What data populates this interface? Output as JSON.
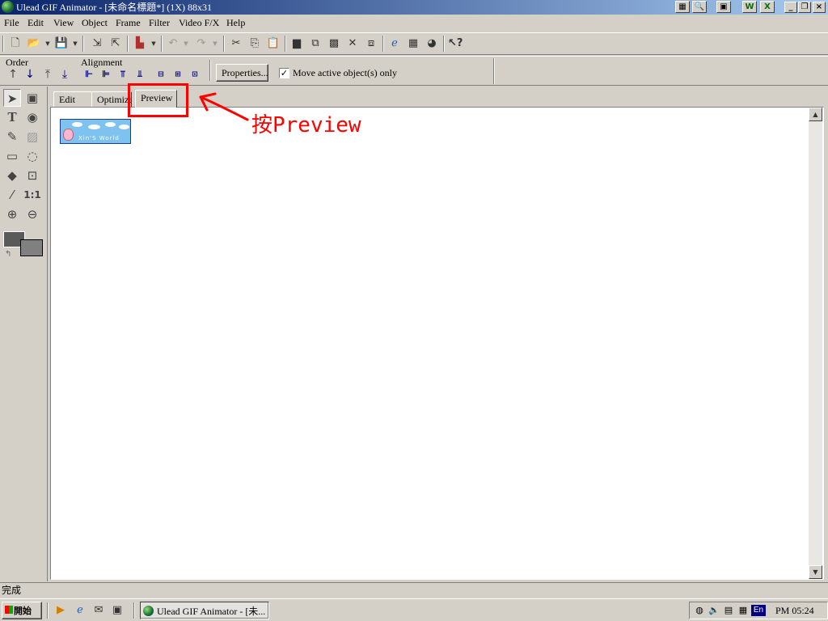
{
  "window": {
    "title": "Ulead GIF Animator - [未命名標題*] (1X) 88x31"
  },
  "menu": [
    "File",
    "Edit",
    "View",
    "Object",
    "Frame",
    "Filter",
    "Video F/X",
    "Help"
  ],
  "toolbar2": {
    "order_label": "Order",
    "alignment_label": "Alignment",
    "properties_button": "Properties...",
    "move_active_label": "Move active object(s) only",
    "move_active_checked": true
  },
  "tabs": [
    {
      "label": "Edit"
    },
    {
      "label": "Optimize"
    },
    {
      "label": "Preview",
      "active": true
    }
  ],
  "banner": {
    "text": "Xin'S World"
  },
  "annotation": {
    "text": "按Preview",
    "color": "#ff0000"
  },
  "status": {
    "text": "完成"
  },
  "taskbar": {
    "start_label": "開始",
    "task_label": "Ulead GIF Animator - [未...",
    "tray_lang": "En",
    "clock": "PM 05:24"
  }
}
